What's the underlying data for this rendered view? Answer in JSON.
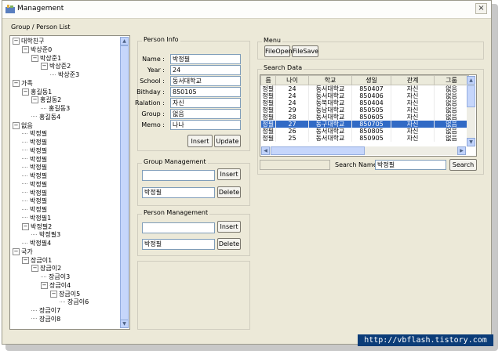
{
  "window": {
    "title": "Management",
    "close_glyph": "×"
  },
  "left": {
    "label": "Group / Person List",
    "tree": [
      {
        "text": "대학친구",
        "level": 0,
        "exp": "−"
      },
      {
        "text": "박상준0",
        "level": 1,
        "exp": "−"
      },
      {
        "text": "박상준1",
        "level": 2,
        "exp": "−"
      },
      {
        "text": "박상준2",
        "level": 3,
        "exp": "−"
      },
      {
        "text": "박상준3",
        "level": 4,
        "exp": ""
      },
      {
        "text": "가족",
        "level": 0,
        "exp": "−"
      },
      {
        "text": "홍길동1",
        "level": 1,
        "exp": "−"
      },
      {
        "text": "홍길동2",
        "level": 2,
        "exp": "−"
      },
      {
        "text": "홍길동3",
        "level": 3,
        "exp": ""
      },
      {
        "text": "홍길동4",
        "level": 2,
        "exp": ""
      },
      {
        "text": "없음",
        "level": 0,
        "exp": "−"
      },
      {
        "text": "박정필",
        "level": 1,
        "exp": ""
      },
      {
        "text": "박정필",
        "level": 1,
        "exp": ""
      },
      {
        "text": "박정필",
        "level": 1,
        "exp": ""
      },
      {
        "text": "박정필",
        "level": 1,
        "exp": ""
      },
      {
        "text": "박정필",
        "level": 1,
        "exp": ""
      },
      {
        "text": "박정필",
        "level": 1,
        "exp": ""
      },
      {
        "text": "박정필",
        "level": 1,
        "exp": ""
      },
      {
        "text": "박정필",
        "level": 1,
        "exp": ""
      },
      {
        "text": "박정필",
        "level": 1,
        "exp": ""
      },
      {
        "text": "박정필",
        "level": 1,
        "exp": ""
      },
      {
        "text": "박정필1",
        "level": 1,
        "exp": ""
      },
      {
        "text": "박정필2",
        "level": 1,
        "exp": "−"
      },
      {
        "text": "박정필3",
        "level": 2,
        "exp": ""
      },
      {
        "text": "박정필4",
        "level": 1,
        "exp": ""
      },
      {
        "text": "국가",
        "level": 0,
        "exp": "−"
      },
      {
        "text": "장금이1",
        "level": 1,
        "exp": "−"
      },
      {
        "text": "장금이2",
        "level": 2,
        "exp": "−"
      },
      {
        "text": "장금이3",
        "level": 3,
        "exp": ""
      },
      {
        "text": "장금이4",
        "level": 3,
        "exp": "−"
      },
      {
        "text": "장금이5",
        "level": 4,
        "exp": "−"
      },
      {
        "text": "장금이6",
        "level": 5,
        "exp": ""
      },
      {
        "text": "장금이7",
        "level": 2,
        "exp": ""
      },
      {
        "text": "장금이8",
        "level": 2,
        "exp": ""
      }
    ]
  },
  "person_info": {
    "title": "Person Info",
    "fields": [
      {
        "label": "Name :",
        "value": "박정필"
      },
      {
        "label": "Year :",
        "value": "24"
      },
      {
        "label": "School :",
        "value": "동서대학교"
      },
      {
        "label": "Bithday :",
        "value": "850105"
      },
      {
        "label": "Ralation :",
        "value": "자신"
      },
      {
        "label": "Group :",
        "value": "없음"
      },
      {
        "label": "Memo :",
        "value": "나나"
      }
    ],
    "insert": "Insert",
    "update": "Update"
  },
  "group_mgmt": {
    "title": "Group Management",
    "input1": "",
    "input2": "박정필",
    "insert": "Insert",
    "delete": "Delete"
  },
  "person_mgmt": {
    "title": "Person Management",
    "input1": "",
    "input2": "박정필",
    "insert": "Insert",
    "delete": "Delete"
  },
  "menu": {
    "title": "Menu",
    "file_open": "FileOpen",
    "file_save": "FileSave"
  },
  "search": {
    "title": "Search Data",
    "columns": [
      "름",
      "나이",
      "학교",
      "생일",
      "관계",
      "그룹"
    ],
    "rows": [
      [
        "정필",
        "24",
        "동서대학교",
        "850407",
        "자신",
        "없음"
      ],
      [
        "정필",
        "24",
        "동서대학교",
        "850406",
        "자신",
        "없음"
      ],
      [
        "정필",
        "24",
        "동북대학교",
        "850404",
        "자신",
        "없음"
      ],
      [
        "정필",
        "29",
        "동남대학교",
        "850505",
        "자신",
        "없음"
      ],
      [
        "정필",
        "28",
        "동서대학교",
        "850605",
        "자신",
        "없음"
      ],
      [
        "정필",
        "27",
        "동구대학교",
        "850705",
        "자신",
        "없음"
      ],
      [
        "정필",
        "26",
        "동서대학교",
        "850805",
        "자신",
        "없음"
      ],
      [
        "정필",
        "25",
        "동서대학교",
        "850905",
        "자신",
        "없음"
      ]
    ],
    "selected_row": 5,
    "left_input": "",
    "name_label": "Search Name :",
    "name_value": "박정필",
    "button": "Search"
  },
  "watermark": "http://vbflash.tistory.com"
}
